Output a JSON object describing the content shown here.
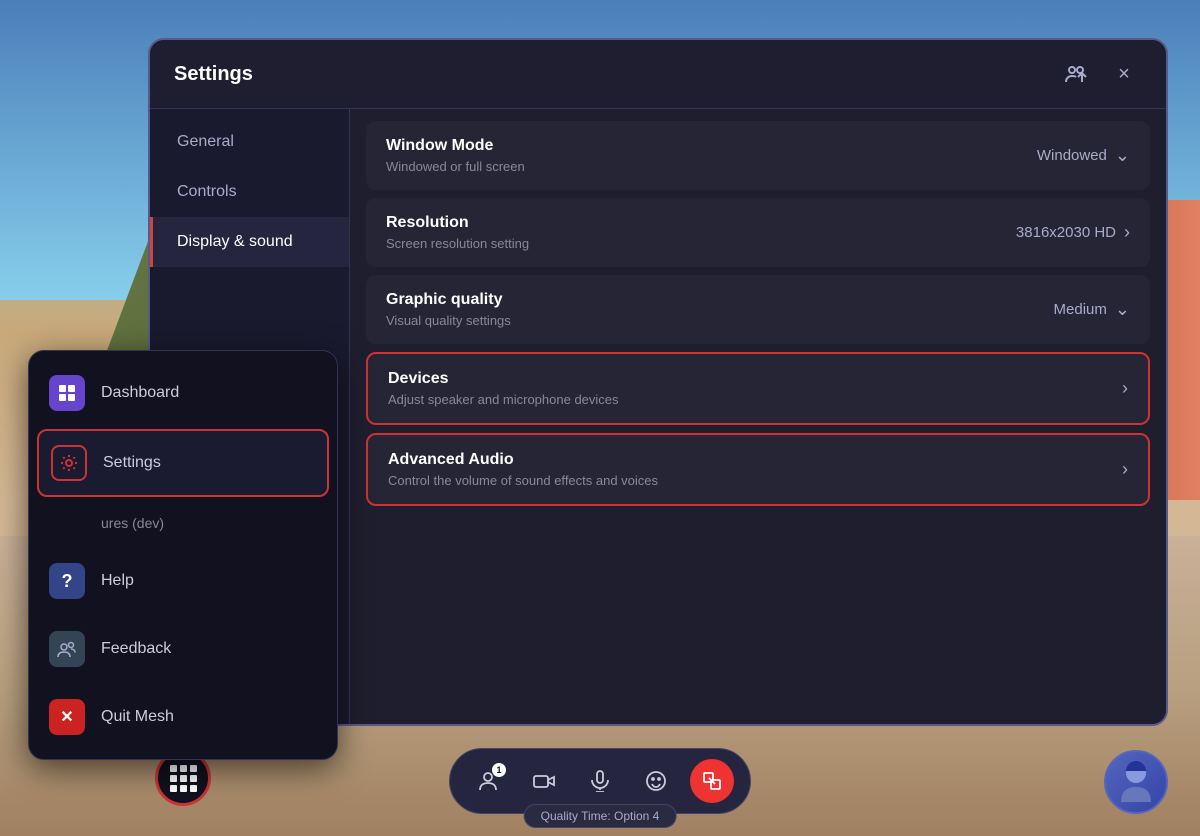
{
  "window": {
    "title": "Settings",
    "close_label": "×"
  },
  "sidebar": {
    "items": [
      {
        "id": "general",
        "label": "General",
        "active": false
      },
      {
        "id": "controls",
        "label": "Controls",
        "active": false
      },
      {
        "id": "display-sound",
        "label": "Display & sound",
        "active": true
      }
    ]
  },
  "settings_rows": [
    {
      "id": "window-mode",
      "title": "Window Mode",
      "subtitle": "Windowed or full screen",
      "value": "Windowed",
      "has_dropdown": true,
      "has_chevron": false,
      "highlighted": false
    },
    {
      "id": "resolution",
      "title": "Resolution",
      "subtitle": "Screen resolution setting",
      "value": "3816x2030 HD",
      "has_dropdown": false,
      "has_chevron": true,
      "highlighted": false
    },
    {
      "id": "graphic-quality",
      "title": "Graphic quality",
      "subtitle": "Visual quality settings",
      "value": "Medium",
      "has_dropdown": true,
      "has_chevron": false,
      "highlighted": false
    },
    {
      "id": "devices",
      "title": "Devices",
      "subtitle": "Adjust speaker and microphone devices",
      "value": "",
      "has_dropdown": false,
      "has_chevron": true,
      "highlighted": true
    },
    {
      "id": "advanced-audio",
      "title": "Advanced Audio",
      "subtitle": "Control the volume of sound effects and voices",
      "value": "",
      "has_dropdown": false,
      "has_chevron": true,
      "highlighted": true
    }
  ],
  "popup_menu": {
    "items": [
      {
        "id": "dashboard",
        "label": "Dashboard",
        "icon_type": "purple"
      },
      {
        "id": "settings",
        "label": "Settings",
        "icon_type": "settings",
        "active": true
      },
      {
        "id": "features-dev",
        "label": "ures (dev)",
        "icon_type": "none"
      },
      {
        "id": "help",
        "label": "Help",
        "icon_type": "help"
      },
      {
        "id": "feedback",
        "label": "Feedback",
        "icon_type": "feedback"
      },
      {
        "id": "quit",
        "label": "Quit Mesh",
        "icon_type": "quit"
      }
    ]
  },
  "toolbar": {
    "person_count": "1",
    "quality_badge": "Quality Time: Option 4"
  },
  "icons": {
    "person": "👤",
    "camera": "📷",
    "mic": "🎤",
    "emoji": "😊",
    "share": "📤",
    "dashboard_icon": "⬛",
    "gear": "⚙",
    "help_q": "?",
    "feedback_person": "👥",
    "quit_x": "✕",
    "grid": "⊞"
  }
}
